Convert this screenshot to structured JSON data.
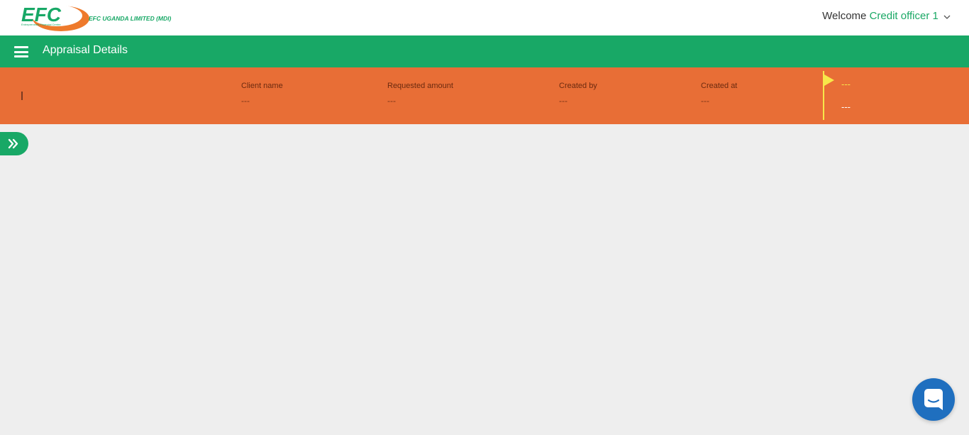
{
  "header": {
    "logo_text": "EFC",
    "company_name": "EFC UGANDA LIMITED (MDI)",
    "logo_tagline": "Entrepreneurs Financial Centre",
    "welcome_label": "Welcome",
    "user_name": "Credit officer 1"
  },
  "navbar": {
    "title": "Appraisal Details"
  },
  "summary": {
    "client_name_label": "Client name",
    "client_name_value": "---",
    "requested_amount_label": "Requested amount",
    "requested_amount_value": "---",
    "created_by_label": "Created by",
    "created_by_value": "---",
    "created_at_label": "Created at",
    "created_at_value": "---",
    "flag_status_value": "---",
    "flag_secondary_value": "---"
  },
  "colors": {
    "brand_green": "#18a866",
    "summary_orange": "#e86e36",
    "flag_yellow": "#f7e84a",
    "chat_blue": "#1f6fbf",
    "background": "#eeeeee"
  },
  "icons": {
    "menu": "hamburger-icon",
    "expand": "double-chevron-right-icon",
    "user_dropdown": "chevron-down-icon",
    "flag": "flag-icon",
    "chat": "chat-icon"
  }
}
